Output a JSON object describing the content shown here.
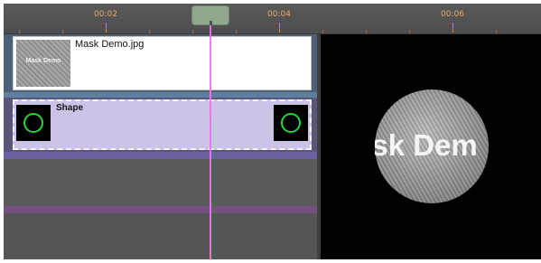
{
  "ruler": {
    "labels": [
      "00:02",
      "00:04",
      "00:06"
    ]
  },
  "tracks": {
    "clip_image": {
      "title": "Mask Demo.jpg",
      "thumb_text": "Mask Demo"
    },
    "clip_shape": {
      "title": "Shape"
    }
  },
  "preview": {
    "text": "ask Dem"
  },
  "colors": {
    "ruler_text": "#e8a860",
    "playhead": "#e878e8",
    "shape_clip": "#cdc3e6",
    "shape_outline": "#29d43a"
  }
}
